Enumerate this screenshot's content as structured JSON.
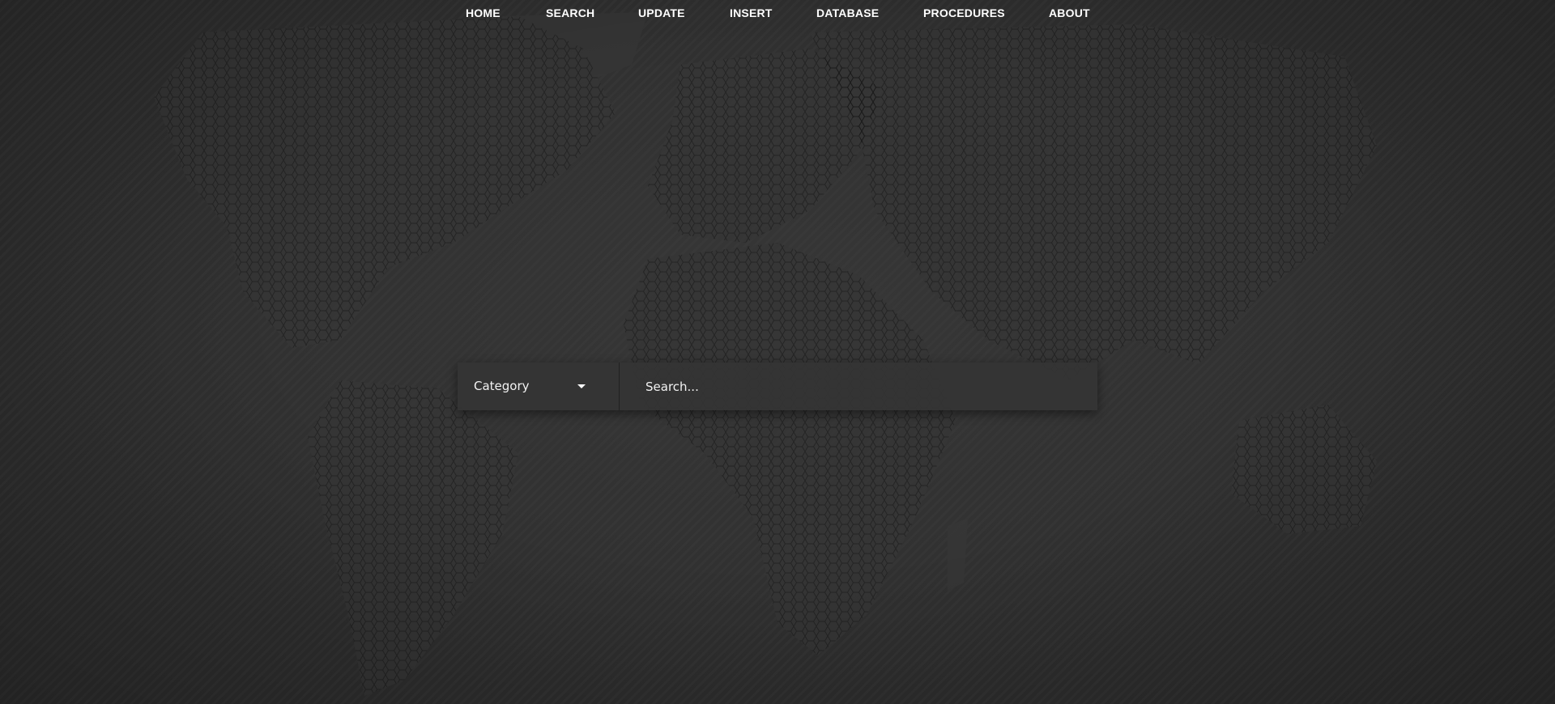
{
  "nav": {
    "items": [
      {
        "label": "HOME"
      },
      {
        "label": "SEARCH"
      },
      {
        "label": "UPDATE"
      },
      {
        "label": "INSERT"
      },
      {
        "label": "DATABASE"
      },
      {
        "label": "PROCEDURES"
      },
      {
        "label": "ABOUT"
      }
    ]
  },
  "search": {
    "category_label": "Category",
    "placeholder": "Search...",
    "value": ""
  },
  "colors": {
    "background": "#2f2f2f",
    "text": "#ffffff",
    "search_bar": "#343434"
  }
}
